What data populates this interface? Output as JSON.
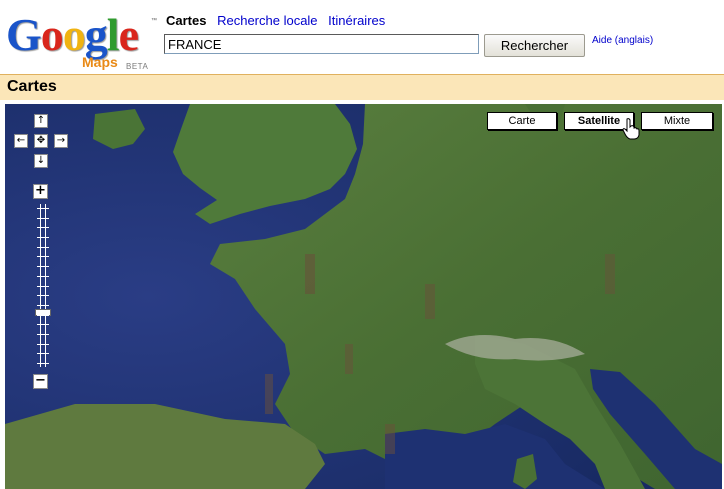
{
  "logo": {
    "letters": [
      "G",
      "o",
      "o",
      "g",
      "l",
      "e"
    ],
    "tm": "™",
    "product": "Maps",
    "badge": "BETA"
  },
  "tabs": [
    {
      "label": "Cartes",
      "active": true
    },
    {
      "label": "Recherche locale",
      "active": false
    },
    {
      "label": "Itinéraires",
      "active": false
    }
  ],
  "search": {
    "value": "FRANCE",
    "button_label": "Rechercher"
  },
  "help_link": "Aide (anglais)",
  "section_title": "Cartes",
  "map": {
    "type_buttons": [
      {
        "label": "Carte",
        "active": false
      },
      {
        "label": "Satellite",
        "active": true
      },
      {
        "label": "Mixte",
        "active": false
      }
    ],
    "pan": {
      "up": "↑",
      "left": "←",
      "center": "✥",
      "right": "→",
      "down": "↓"
    },
    "zoom": {
      "in": "+",
      "out": "−",
      "level_fraction": 0.68
    }
  },
  "colors": {
    "title_bar": "#fbe6b8",
    "link": "#0000cc",
    "ocean": "#1d2f6e",
    "land": "#4f7a3a"
  }
}
